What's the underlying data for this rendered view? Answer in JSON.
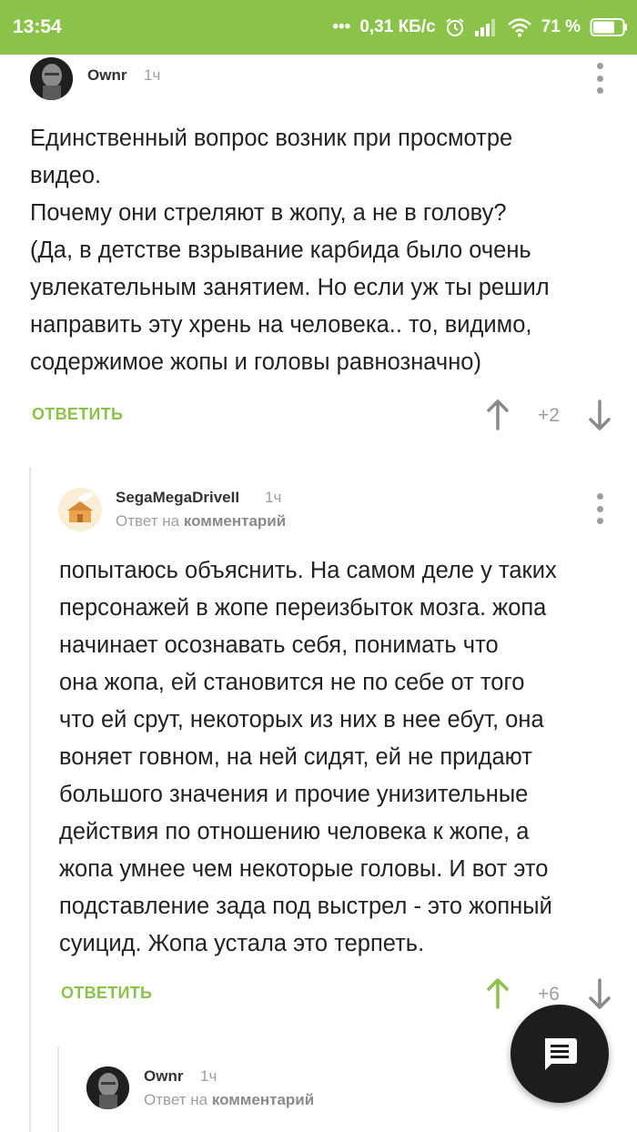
{
  "status_bar": {
    "time": "13:54",
    "dots": "•••",
    "network_speed": "0,31 КБ/с",
    "battery_percent": "71 %",
    "color": "#8bc34a"
  },
  "comments": [
    {
      "author": "Ownr",
      "time": "1ч",
      "text": "Единственный вопрос возник при просмотре\nвидео.\nПочему они стреляют в жопу, а не в голову?\n(Да, в детстве взрывание карбида было очень\nувлекательным занятием.  Но если уж ты решил\nнаправить эту хрень на человека.. то, видимо,\nсодержимое жопы и головы равнозначно)",
      "reply_label": "ОТВЕТИТЬ",
      "score": "+2",
      "upvoted": false
    },
    {
      "author": "SegaMegaDriveII",
      "time": "1ч",
      "reply_to_prefix": "Ответ на",
      "reply_to_link": "комментарий",
      "text": "попытаюсь объяснить. На самом деле у таких\nперсонажей в жопе переизбыток мозга. жопа\nначинает осознавать себя, понимать что\nона жопа, ей становится не по себе от того\nчто ей срут, некоторых из них в нее ебут, она\nвоняет говном, на ней сидят, ей не придают\nбольшого значения и прочие унизительные\nдействия по отношению человека к жопе, а\nжопа умнее чем некоторые головы. И вот это\nподставление зада под выстрел - это жопный\nсуицид. Жопа устала это терпеть.",
      "reply_label": "ОТВЕТИТЬ",
      "score": "+6",
      "upvoted": true
    },
    {
      "author": "Ownr",
      "time": "1ч",
      "reply_to_prefix": "Ответ на",
      "reply_to_link": "комментарий"
    }
  ],
  "fab": {
    "icon": "comment-icon"
  },
  "colors": {
    "accent": "#8bc34a",
    "muted": "#9e9e9e",
    "fab": "#1d1d1d"
  }
}
